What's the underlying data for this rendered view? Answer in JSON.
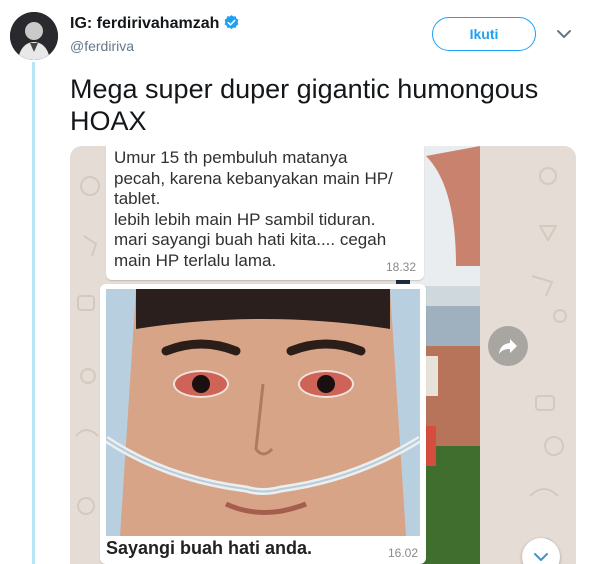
{
  "tweet": {
    "display_name": "IG: ferdirivahamzah",
    "handle": "@ferdiriva",
    "follow_label": "Ikuti",
    "text": "Mega super duper gigantic humongous HOAX",
    "accent_color": "#1da1f2"
  },
  "media": {
    "message_text": "Umur 15 th pembuluh matanya\npecah, karena kebanyakan main HP/\ntablet.\nlebih lebih main HP sambil tiduran.\nmari sayangi buah hati kita.... cegah\nmain HP terlalu lama.",
    "message_time": "18.32",
    "photo_caption": "Sayangi buah hati anda.",
    "photo_time": "16.02"
  }
}
